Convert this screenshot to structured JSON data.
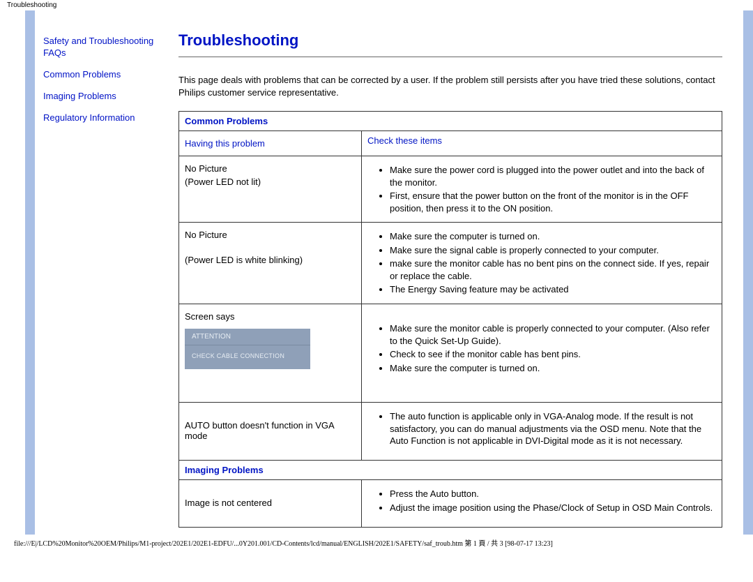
{
  "header_label": "Troubleshooting",
  "sidebar": {
    "items": [
      {
        "label": "Safety and Troubleshooting"
      },
      {
        "label": "FAQs"
      },
      {
        "label": "Common Problems"
      },
      {
        "label": "Imaging Problems"
      },
      {
        "label": "Regulatory Information"
      }
    ]
  },
  "main": {
    "title": "Troubleshooting",
    "intro": "This page deals with problems that can be corrected by a user. If the problem still persists after you have tried these solutions, contact Philips customer service representative."
  },
  "table": {
    "common_problems_header": "Common Problems",
    "col_left": "Having this problem",
    "col_right": "Check these items",
    "rows": [
      {
        "problem_title": "No Picture",
        "problem_sub": "(Power LED not lit)",
        "checks": [
          "Make sure the power cord is plugged into the power outlet and into the back of the monitor.",
          "First, ensure that the power button on the front of the monitor is in the OFF position, then press it to the ON position."
        ]
      },
      {
        "problem_title": "No Picture",
        "problem_sub": "(Power LED is white blinking)",
        "checks": [
          "Make sure the computer is turned on.",
          "Make sure the signal cable is properly connected to your computer.",
          "make sure the monitor cable has no bent pins on the connect side. If yes, repair or replace the cable.",
          "The Energy Saving feature may be activated"
        ]
      },
      {
        "problem_title": "Screen says",
        "attention_head": "ATTENTION",
        "attention_body": "CHECK CABLE CONNECTION",
        "checks": [
          "Make sure the monitor cable is properly connected to your computer. (Also refer to the Quick Set-Up Guide).",
          "Check to see if the monitor cable has bent pins.",
          "Make sure the computer is turned on."
        ]
      },
      {
        "problem_title": "AUTO button doesn't function in VGA mode",
        "checks": [
          "The auto function is applicable only in VGA-Analog mode.  If the result is not satisfactory, you can do manual adjustments via the OSD menu.  Note that the Auto Function is not applicable in DVI-Digital mode as it is not necessary."
        ]
      }
    ],
    "imaging_problems_header": "Imaging Problems",
    "imaging_rows": [
      {
        "problem_title": "Image is not centered",
        "checks": [
          "Press the Auto button.",
          "Adjust the image position using the Phase/Clock of Setup in OSD Main Controls."
        ]
      }
    ]
  },
  "footer": "file:///E|/LCD%20Monitor%20OEM/Philips/M1-project/202E1/202E1-EDFU/...0Y201.001/CD-Contents/lcd/manual/ENGLISH/202E1/SAFETY/saf_troub.htm 第 1 頁 / 共 3  [98-07-17 13:23]"
}
